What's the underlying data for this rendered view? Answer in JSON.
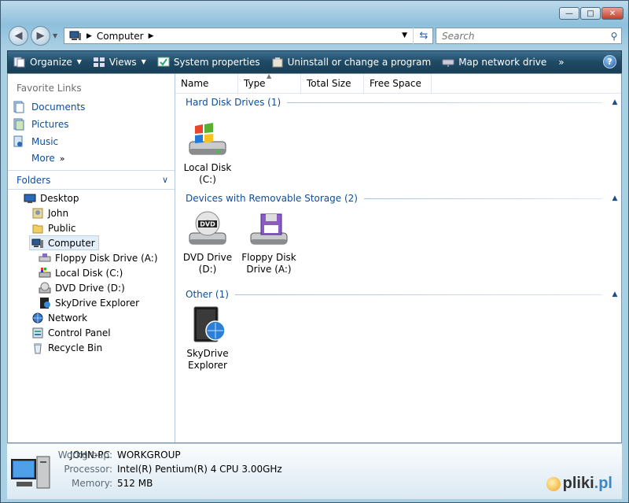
{
  "window": {
    "caption_buttons": [
      "minimize-icon",
      "maximize-icon",
      "close-icon"
    ]
  },
  "address": {
    "path": "Computer",
    "search_placeholder": "Search"
  },
  "toolbar": {
    "organize": "Organize",
    "views": "Views",
    "system_properties": "System properties",
    "uninstall": "Uninstall or change a program",
    "map_drive": "Map network drive",
    "more": "»",
    "help": "?"
  },
  "nav": {
    "favorite_title": "Favorite Links",
    "favorites": [
      {
        "label": "Documents",
        "icon": "documents-icon"
      },
      {
        "label": "Pictures",
        "icon": "pictures-icon"
      },
      {
        "label": "Music",
        "icon": "music-icon"
      },
      {
        "label": "More",
        "icon": "more-icon"
      }
    ],
    "folders_title": "Folders",
    "tree": [
      {
        "label": "Desktop",
        "icon": "desktop-icon"
      },
      {
        "label": "John",
        "icon": "user-folder-icon"
      },
      {
        "label": "Public",
        "icon": "folder-icon"
      },
      {
        "label": "Computer",
        "icon": "computer-icon"
      },
      {
        "label": "Floppy Disk Drive (A:)",
        "icon": "floppy-icon"
      },
      {
        "label": "Local Disk (C:)",
        "icon": "hard-disk-icon"
      },
      {
        "label": "DVD Drive (D:)",
        "icon": "dvd-icon"
      },
      {
        "label": "SkyDrive Explorer",
        "icon": "skydrive-icon"
      },
      {
        "label": "Network",
        "icon": "network-icon"
      },
      {
        "label": "Control Panel",
        "icon": "control-panel-icon"
      },
      {
        "label": "Recycle Bin",
        "icon": "recycle-bin-icon"
      }
    ]
  },
  "columns": [
    "Name",
    "Type",
    "Total Size",
    "Free Space"
  ],
  "groups": [
    {
      "title": "Hard Disk Drives (1)",
      "items": [
        {
          "line1": "Local Disk",
          "line2": "(C:)"
        }
      ]
    },
    {
      "title": "Devices with Removable Storage (2)",
      "items": [
        {
          "line1": "DVD Drive",
          "line2": "(D:)"
        },
        {
          "line1": "Floppy Disk",
          "line2": "Drive (A:)"
        }
      ]
    },
    {
      "title": "Other (1)",
      "items": [
        {
          "line1": "SkyDrive",
          "line2": "Explorer"
        }
      ]
    }
  ],
  "details": {
    "pc_name": "JOHN-PC",
    "rows": [
      {
        "label": "Workgroup:",
        "value": "WORKGROUP"
      },
      {
        "label": "Processor:",
        "value": "Intel(R) Pentium(R) 4 CPU 3.00GHz"
      },
      {
        "label": "Memory:",
        "value": "512 MB"
      }
    ],
    "brand": "pliki",
    "brand_tld": ".pl"
  },
  "colors": {
    "toolbar": "#1f4a66",
    "link": "#0c4ea2"
  }
}
